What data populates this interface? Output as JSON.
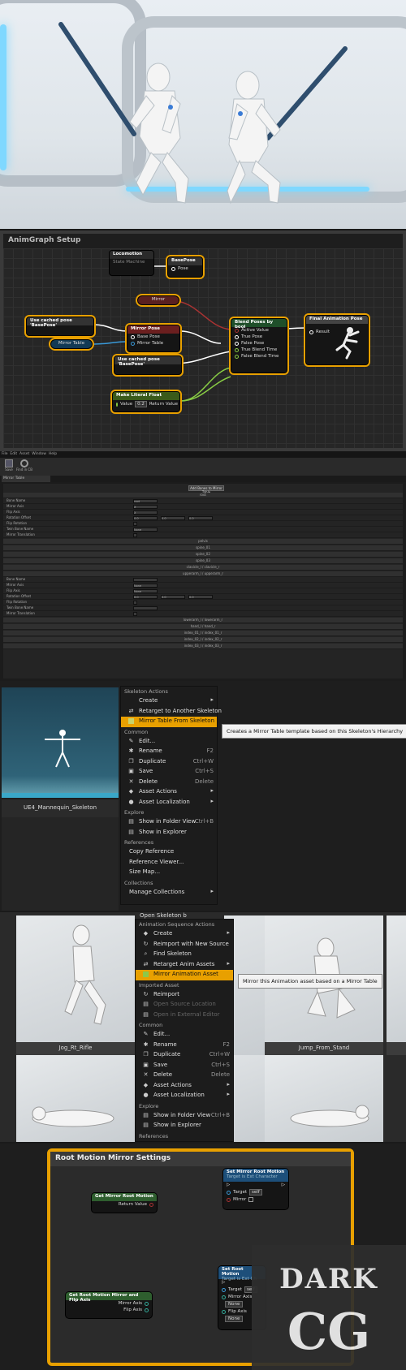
{
  "animgraph": {
    "title": "AnimGraph Setup",
    "locomotion": {
      "title": "Locomotion",
      "subtitle": "State Machine"
    },
    "basepose": {
      "title": "BasePose",
      "pin": "Pose"
    },
    "mirror_var": "Mirror",
    "cached1": "Use cached pose 'BasePose'",
    "cached2": "Use cached pose 'BasePose'",
    "mirrorpose": {
      "title": "Mirror Pose",
      "pin1": "Base Pose",
      "pin2": "Mirror Table"
    },
    "mirrortable_var": "Mirror Table",
    "blend": {
      "title": "Blend Poses by bool",
      "p1": "Active Value",
      "p2": "True Pose",
      "p3": "False Pose",
      "p4": "True Blend Time",
      "p5": "False Blend Time"
    },
    "final": {
      "title": "Final Animation Pose",
      "pin": "Result"
    },
    "literal": {
      "title": "Make Literal Float",
      "value_label": "Value",
      "value": "0.2",
      "ret": "Return Value"
    }
  },
  "editor": {
    "menubar": [
      "File",
      "Edit",
      "Asset",
      "Window",
      "Help"
    ],
    "tab": "Mirror Table",
    "toolbar": [
      "Save",
      "Find in CB"
    ],
    "button": "Add Bones to Mirror Table",
    "section1": "root",
    "fields1": [
      "Bone Name",
      "Mirror Axis",
      "Flip Axis",
      "Rotation Offset",
      "Flip Rotation",
      "Twin Bone Name",
      "Mirror Translation"
    ],
    "rows": [
      "pelvis",
      "spine_01",
      "spine_02",
      "spine_03",
      "clavicle_l / clavicle_r"
    ],
    "section2": "upperarm_l / upperarm_r",
    "fields2": [
      "Bone Name",
      "Mirror Axis",
      "Flip Axis",
      "Rotation Offset",
      "Flip Rotation",
      "Twin Bone Name",
      "Mirror Translation"
    ],
    "rows2": [
      "lowerarm_l / lowerarm_r",
      "hand_l / hand_r",
      "index_01_l / index_01_r",
      "index_02_l / index_02_r",
      "index_03_l / index_03_r"
    ],
    "vals": {
      "root": "root",
      "x": "X",
      "none": "None",
      "zero": "0.0"
    }
  },
  "menu1": {
    "thumb_label": "UE4_Mannequin_Skeleton",
    "h1": "Skeleton Actions",
    "items1": [
      {
        "label": "Create",
        "arrow": "▸"
      },
      {
        "label": "Retarget to Another Skeleton"
      },
      {
        "label": "Mirror Table From Skeleton"
      }
    ],
    "h2": "Common",
    "items2": [
      {
        "label": "Edit..."
      },
      {
        "label": "Rename",
        "sc": "F2"
      },
      {
        "label": "Duplicate",
        "sc": "Ctrl+W"
      },
      {
        "label": "Save",
        "sc": "Ctrl+S"
      },
      {
        "label": "Delete",
        "sc": "Delete"
      },
      {
        "label": "Asset Actions",
        "arrow": "▸"
      },
      {
        "label": "Asset Localization",
        "arrow": "▸"
      }
    ],
    "h3": "Explore",
    "items3": [
      {
        "label": "Show in Folder View",
        "sc": "Ctrl+B"
      },
      {
        "label": "Show in Explorer"
      }
    ],
    "h4": "References",
    "items4": [
      {
        "label": "Copy Reference"
      },
      {
        "label": "Reference Viewer..."
      },
      {
        "label": "Size Map..."
      }
    ],
    "h5": "Collections",
    "items5": [
      {
        "label": "Manage Collections",
        "arrow": "▸"
      }
    ],
    "tooltip": "Creates a Mirror Table template based on this Skeleton's Hierarchy"
  },
  "menu2": {
    "card1": "Jog_Rt_Rifle",
    "card2": "Jump_From_Stand",
    "peek": "Open Skeleton b",
    "h1": "Animation Sequence Actions",
    "items1": [
      {
        "label": "Create",
        "arrow": "▸"
      },
      {
        "label": "Reimport with New Source"
      },
      {
        "label": "Find Skeleton"
      },
      {
        "label": "Retarget Anim Assets",
        "arrow": "▸"
      },
      {
        "label": "Mirror Animation Asset"
      }
    ],
    "h2": "Imported Asset",
    "items2": [
      {
        "label": "Reimport"
      },
      {
        "label": "Open Source Location"
      },
      {
        "label": "Open in External Editor"
      }
    ],
    "h3": "Common",
    "items3": [
      {
        "label": "Edit..."
      },
      {
        "label": "Rename",
        "sc": "F2"
      },
      {
        "label": "Duplicate",
        "sc": "Ctrl+W"
      },
      {
        "label": "Save",
        "sc": "Ctrl+S"
      },
      {
        "label": "Delete",
        "sc": "Delete"
      },
      {
        "label": "Asset Actions",
        "arrow": "▸"
      },
      {
        "label": "Asset Localization",
        "arrow": "▸"
      }
    ],
    "h4": "Explore",
    "items4": [
      {
        "label": "Show in Folder View",
        "sc": "Ctrl+B"
      },
      {
        "label": "Show in Explorer"
      }
    ],
    "h5": "References",
    "tooltip": "Mirror this Animation asset based on a Mirror Table"
  },
  "rootmotion": {
    "title": "Root Motion Mirror Settings",
    "getmirror": {
      "title": "Get Mirror Root Motion",
      "pin": "Return Value"
    },
    "setmirror": {
      "title": "Set Mirror Root Motion",
      "sub": "Target is Ext Character",
      "target": "Target",
      "self": "self",
      "mirror": "Mirror"
    },
    "getflip": {
      "title": "Get Root Motion Mirror and Flip Axis",
      "pin1": "Mirror Axis",
      "pin2": "Flip Axis"
    },
    "setflip": {
      "title": "Set Root Motion",
      "sub": "Target is Ext Ch",
      "target": "Target",
      "self": "self",
      "p1": "Mirror Axis",
      "v1": "None",
      "p2": "Flip Axis",
      "v2": "None"
    }
  },
  "watermark": {
    "line1": "DARK",
    "line2": "CG"
  }
}
